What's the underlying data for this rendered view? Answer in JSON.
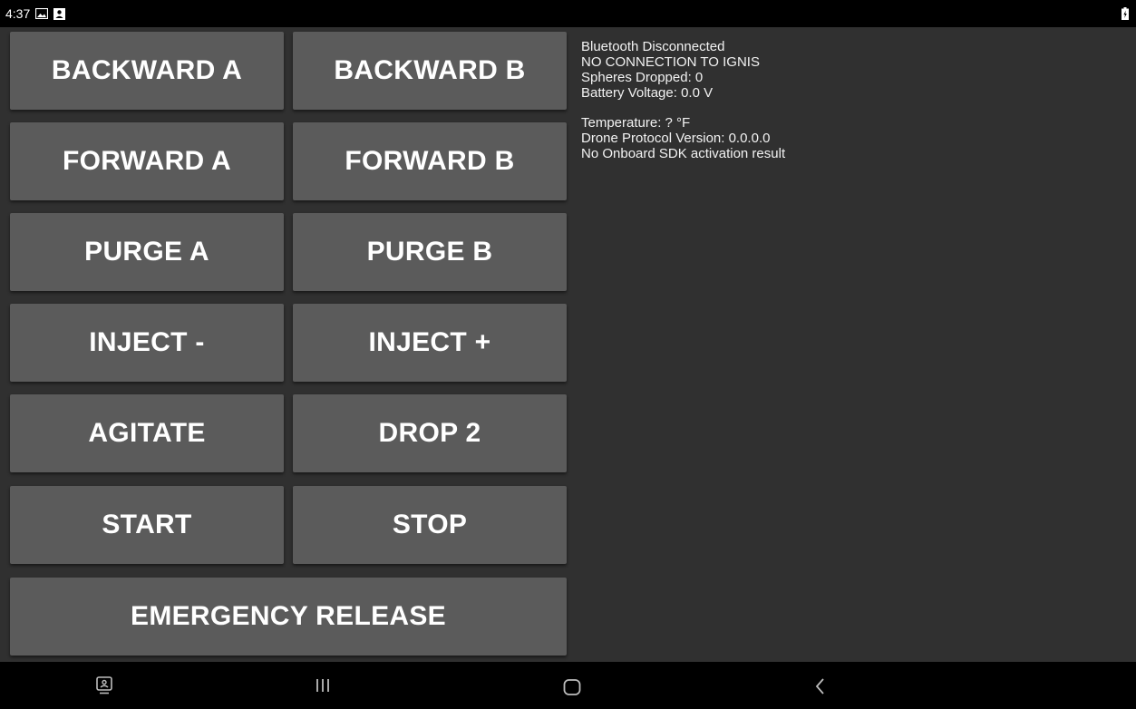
{
  "status_bar": {
    "time": "4:37",
    "icons": [
      "image-icon",
      "person-card-icon"
    ],
    "battery_icon": "battery-charging-icon"
  },
  "controls": {
    "backward_a": "BACKWARD A",
    "backward_b": "BACKWARD B",
    "forward_a": "FORWARD A",
    "forward_b": "FORWARD B",
    "purge_a": "PURGE A",
    "purge_b": "PURGE B",
    "inject_minus": "INJECT -",
    "inject_plus": "INJECT +",
    "agitate": "AGITATE",
    "drop_2": "DROP 2",
    "start": "START",
    "stop": "STOP",
    "emergency_release": "EMERGENCY RELEASE"
  },
  "info": {
    "bluetooth_status": "Bluetooth Disconnected",
    "connection_status": "NO CONNECTION TO IGNIS",
    "spheres_dropped": "Spheres Dropped: 0",
    "battery_voltage": "Battery Voltage: 0.0 V",
    "temperature": "Temperature: ? °F",
    "protocol_version": "Drone Protocol Version: 0.0.0.0",
    "sdk_activation": "No Onboard SDK activation result"
  },
  "nav_bar": {
    "buttons": [
      "screen-mirror-icon",
      "recent-apps-icon",
      "home-icon",
      "back-icon"
    ]
  },
  "colors": {
    "background": "#303030",
    "button": "#5b5b5b",
    "bars": "#000000",
    "text": "#ffffff"
  }
}
